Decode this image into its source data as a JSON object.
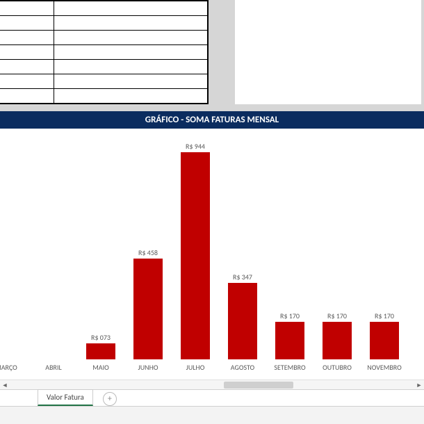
{
  "chart_data": {
    "type": "bar",
    "title": "GRÁFICO - SOMA FATURAS MENSAL",
    "ylabel": "",
    "xlabel": "",
    "ylim": [
      0,
      1000
    ],
    "categories": [
      "MARÇO",
      "ABRIL",
      "MAIO",
      "JUNHO",
      "JULHO",
      "AGOSTO",
      "SETEMBRO",
      "OUTUBRO",
      "NOVEMBRO"
    ],
    "values": [
      null,
      null,
      73,
      458,
      944,
      347,
      170,
      170,
      170
    ],
    "value_labels": [
      "",
      "",
      "R$ 073",
      "R$ 458",
      "R$ 944",
      "R$ 347",
      "R$ 170",
      "R$ 170",
      "R$ 170"
    ],
    "bar_color": "#c00000"
  },
  "sheet": {
    "tab_label": "Valor Fatura",
    "add_icon": "+"
  },
  "scroll": {
    "left": "◄",
    "right": "►"
  }
}
